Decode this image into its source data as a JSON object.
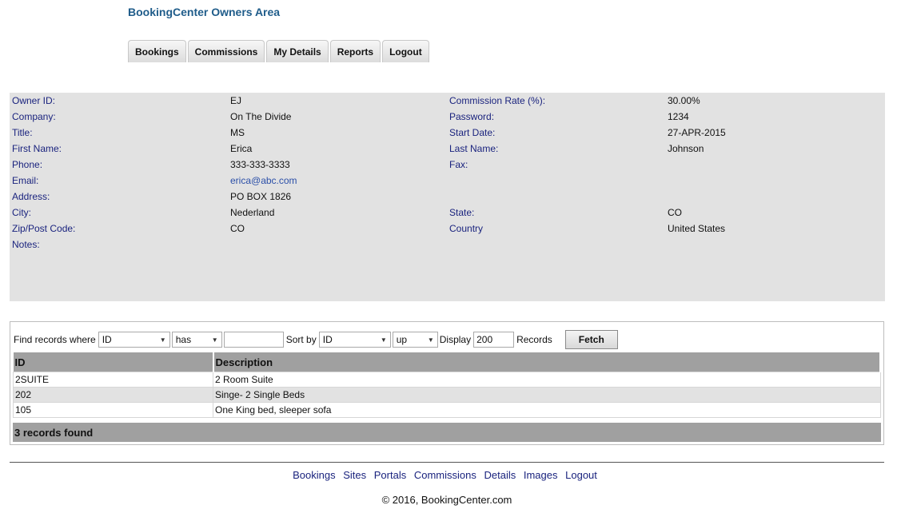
{
  "header": {
    "title": "BookingCenter Owners Area"
  },
  "tabs": [
    {
      "label": "Bookings"
    },
    {
      "label": "Commissions"
    },
    {
      "label": "My Details"
    },
    {
      "label": "Reports"
    },
    {
      "label": "Logout"
    }
  ],
  "owner": {
    "owner_id_label": "Owner ID:",
    "owner_id": "EJ",
    "commission_rate_label": "Commission Rate (%):",
    "commission_rate": "30.00%",
    "company_label": "Company:",
    "company": "On The Divide",
    "password_label": "Password:",
    "password": "1234",
    "title_label": "Title:",
    "title": "MS",
    "start_date_label": "Start Date:",
    "start_date": "27-APR-2015",
    "first_name_label": "First Name:",
    "first_name": "Erica",
    "last_name_label": "Last Name:",
    "last_name": "Johnson",
    "phone_label": "Phone:",
    "phone": "333-333-3333",
    "fax_label": "Fax:",
    "fax": "",
    "email_label": "Email:",
    "email": "erica@abc.com",
    "address_label": "Address:",
    "address": "PO BOX 1826",
    "city_label": "City:",
    "city": "Nederland",
    "state_label": "State:",
    "state": "CO",
    "zip_label": "Zip/Post Code:",
    "zip": "CO",
    "country_label": "Country",
    "country": "United States",
    "notes_label": "Notes:",
    "notes": ""
  },
  "filter": {
    "find_label": "Find records where",
    "field_value": "ID",
    "operator_value": "has",
    "search_value": "",
    "sort_label": "Sort by",
    "sort_value": "ID",
    "direction_value": "up",
    "display_label": "Display",
    "display_value": "200",
    "records_label": "Records",
    "fetch_label": "Fetch"
  },
  "table": {
    "columns": [
      "ID",
      "Description"
    ],
    "rows": [
      {
        "id": "2SUITE",
        "description": "2 Room Suite"
      },
      {
        "id": "202",
        "description": "Singe- 2 Single Beds"
      },
      {
        "id": "105",
        "description": "One King bed, sleeper sofa"
      }
    ],
    "footer": "3 records found"
  },
  "footer_nav": [
    {
      "label": "Bookings"
    },
    {
      "label": "Sites"
    },
    {
      "label": "Portals"
    },
    {
      "label": "Commissions"
    },
    {
      "label": "Details"
    },
    {
      "label": "Images"
    },
    {
      "label": "Logout"
    }
  ],
  "copyright": "© 2016, BookingCenter.com"
}
